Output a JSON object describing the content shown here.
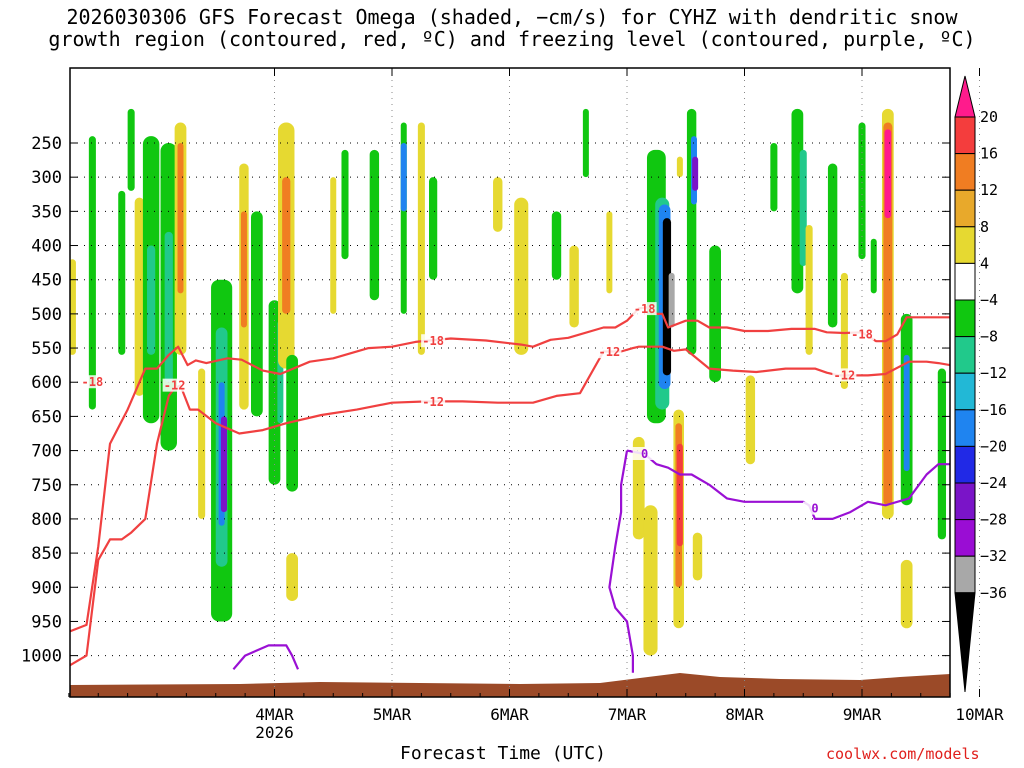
{
  "title_line1": "2026030306 GFS Forecast Omega (shaded, −cm/s) for CYHZ with dendritic snow",
  "title_line2": "growth region (contoured, red, ºC) and freezing level (contoured, purple, ºC)",
  "credit": "coolwx.com/models",
  "chart_data": {
    "type": "heatmap",
    "title": "2026030306 GFS Forecast Omega (shaded, −cm/s) for CYHZ with dendritic snow growth region (contoured, red, ºC) and freezing level (contoured, purple, ºC)",
    "xlabel": "Forecast Time (UTC)",
    "ylabel": "",
    "x_ticks": [
      {
        "label": "4MAR",
        "sub": "2026",
        "day": 1
      },
      {
        "label": "5MAR",
        "sub": "",
        "day": 2
      },
      {
        "label": "6MAR",
        "sub": "",
        "day": 3
      },
      {
        "label": "7MAR",
        "sub": "",
        "day": 4
      },
      {
        "label": "8MAR",
        "sub": "",
        "day": 5
      },
      {
        "label": "9MAR",
        "sub": "",
        "day": 6
      },
      {
        "label": "10MAR",
        "sub": "",
        "day": 7
      }
    ],
    "xlim_days": [
      -0.75,
      6.75
    ],
    "y_ticks": [
      250,
      300,
      350,
      400,
      450,
      500,
      550,
      600,
      650,
      700,
      750,
      800,
      850,
      900,
      950,
      1000
    ],
    "ylim_hpa": [
      200,
      1025
    ],
    "y_scale": "linear-pressure",
    "grid": "dotted",
    "colorbar": {
      "labels": [
        "20",
        "16",
        "12",
        "8",
        "4",
        "−4",
        "−8",
        "−12",
        "−16",
        "−20",
        "−24",
        "−28",
        "−32",
        "−36"
      ],
      "colors": [
        "#ff1b8c",
        "#f43d3d",
        "#f07d22",
        "#e8a92b",
        "#e6d931",
        "#ffffff",
        "#10c710",
        "#21c98b",
        "#22b8d6",
        "#1f84f0",
        "#2129e6",
        "#7a14c8",
        "#9a0dd4",
        "#a8a8a8",
        "#000000"
      ]
    },
    "omega_regions": [
      {
        "x": -0.72,
        "p1": 420,
        "p2": 560,
        "hw": 0.03,
        "c": "#e6d931"
      },
      {
        "x": -0.55,
        "p1": 240,
        "p2": 640,
        "hw": 0.03,
        "c": "#10c710"
      },
      {
        "x": -0.3,
        "p1": 320,
        "p2": 560,
        "hw": 0.03,
        "c": "#10c710"
      },
      {
        "x": -0.15,
        "p1": 330,
        "p2": 620,
        "hw": 0.04,
        "c": "#e6d931"
      },
      {
        "x": -0.22,
        "p1": 200,
        "p2": 320,
        "hw": 0.03,
        "c": "#10c710"
      },
      {
        "x": -0.05,
        "p1": 240,
        "p2": 660,
        "hw": 0.07,
        "c": "#10c710"
      },
      {
        "x": -0.05,
        "p1": 400,
        "p2": 560,
        "hw": 0.035,
        "c": "#21c98b"
      },
      {
        "x": 0.1,
        "p1": 250,
        "p2": 700,
        "hw": 0.07,
        "c": "#10c710"
      },
      {
        "x": 0.1,
        "p1": 380,
        "p2": 600,
        "hw": 0.035,
        "c": "#21c98b"
      },
      {
        "x": 0.2,
        "p1": 220,
        "p2": 560,
        "hw": 0.05,
        "c": "#e6d931"
      },
      {
        "x": 0.2,
        "p1": 250,
        "p2": 470,
        "hw": 0.025,
        "c": "#f07d22"
      },
      {
        "x": 0.55,
        "p1": 450,
        "p2": 950,
        "hw": 0.09,
        "c": "#10c710"
      },
      {
        "x": 0.55,
        "p1": 520,
        "p2": 870,
        "hw": 0.05,
        "c": "#21c98b"
      },
      {
        "x": 0.55,
        "p1": 600,
        "p2": 810,
        "hw": 0.025,
        "c": "#1f84f0"
      },
      {
        "x": 0.57,
        "p1": 650,
        "p2": 790,
        "hw": 0.015,
        "c": "#7a14c8"
      },
      {
        "x": 0.38,
        "p1": 580,
        "p2": 800,
        "hw": 0.03,
        "c": "#e6d931"
      },
      {
        "x": 0.74,
        "p1": 280,
        "p2": 640,
        "hw": 0.04,
        "c": "#e6d931"
      },
      {
        "x": 0.74,
        "p1": 350,
        "p2": 520,
        "hw": 0.02,
        "c": "#f07d22"
      },
      {
        "x": 0.85,
        "p1": 350,
        "p2": 650,
        "hw": 0.05,
        "c": "#10c710"
      },
      {
        "x": 1.0,
        "p1": 480,
        "p2": 750,
        "hw": 0.05,
        "c": "#10c710"
      },
      {
        "x": 1.05,
        "p1": 510,
        "p2": 660,
        "hw": 0.025,
        "c": "#21c98b"
      },
      {
        "x": 1.1,
        "p1": 220,
        "p2": 580,
        "hw": 0.07,
        "c": "#e6d931"
      },
      {
        "x": 1.1,
        "p1": 300,
        "p2": 500,
        "hw": 0.035,
        "c": "#f07d22"
      },
      {
        "x": 1.15,
        "p1": 560,
        "p2": 760,
        "hw": 0.05,
        "c": "#10c710"
      },
      {
        "x": 1.15,
        "p1": 850,
        "p2": 920,
        "hw": 0.05,
        "c": "#e6d931"
      },
      {
        "x": 1.5,
        "p1": 300,
        "p2": 500,
        "hw": 0.02,
        "c": "#e6d931"
      },
      {
        "x": 1.6,
        "p1": 260,
        "p2": 420,
        "hw": 0.03,
        "c": "#10c710"
      },
      {
        "x": 1.85,
        "p1": 260,
        "p2": 480,
        "hw": 0.04,
        "c": "#10c710"
      },
      {
        "x": 2.1,
        "p1": 220,
        "p2": 500,
        "hw": 0.025,
        "c": "#10c710"
      },
      {
        "x": 2.1,
        "p1": 250,
        "p2": 350,
        "hw": 0.012,
        "c": "#1f84f0"
      },
      {
        "x": 2.25,
        "p1": 220,
        "p2": 560,
        "hw": 0.03,
        "c": "#e6d931"
      },
      {
        "x": 2.35,
        "p1": 300,
        "p2": 450,
        "hw": 0.035,
        "c": "#10c710"
      },
      {
        "x": 2.9,
        "p1": 300,
        "p2": 380,
        "hw": 0.04,
        "c": "#e6d931"
      },
      {
        "x": 3.1,
        "p1": 330,
        "p2": 560,
        "hw": 0.06,
        "c": "#e6d931"
      },
      {
        "x": 3.4,
        "p1": 350,
        "p2": 450,
        "hw": 0.04,
        "c": "#10c710"
      },
      {
        "x": 3.55,
        "p1": 400,
        "p2": 520,
        "hw": 0.04,
        "c": "#e6d931"
      },
      {
        "x": 3.65,
        "p1": 200,
        "p2": 300,
        "hw": 0.015,
        "c": "#10c710"
      },
      {
        "x": 3.85,
        "p1": 350,
        "p2": 470,
        "hw": 0.02,
        "c": "#e6d931"
      },
      {
        "x": 4.1,
        "p1": 680,
        "p2": 830,
        "hw": 0.05,
        "c": "#e6d931"
      },
      {
        "x": 4.2,
        "p1": 780,
        "p2": 1000,
        "hw": 0.06,
        "c": "#e6d931"
      },
      {
        "x": 4.25,
        "p1": 260,
        "p2": 660,
        "hw": 0.08,
        "c": "#10c710"
      },
      {
        "x": 4.3,
        "p1": 330,
        "p2": 640,
        "hw": 0.06,
        "c": "#21c98b"
      },
      {
        "x": 4.32,
        "p1": 340,
        "p2": 610,
        "hw": 0.05,
        "c": "#1f84f0"
      },
      {
        "x": 4.34,
        "p1": 360,
        "p2": 590,
        "hw": 0.035,
        "c": "#000000"
      },
      {
        "x": 4.38,
        "p1": 440,
        "p2": 520,
        "hw": 0.025,
        "c": "#a8a8a8"
      },
      {
        "x": 4.44,
        "p1": 640,
        "p2": 960,
        "hw": 0.045,
        "c": "#e6d931"
      },
      {
        "x": 4.44,
        "p1": 660,
        "p2": 900,
        "hw": 0.028,
        "c": "#f07d22"
      },
      {
        "x": 4.45,
        "p1": 690,
        "p2": 840,
        "hw": 0.018,
        "c": "#f43d3d"
      },
      {
        "x": 4.55,
        "p1": 200,
        "p2": 560,
        "hw": 0.04,
        "c": "#10c710"
      },
      {
        "x": 4.57,
        "p1": 240,
        "p2": 340,
        "hw": 0.02,
        "c": "#1f84f0"
      },
      {
        "x": 4.58,
        "p1": 270,
        "p2": 320,
        "hw": 0.012,
        "c": "#7a14c8"
      },
      {
        "x": 4.45,
        "p1": 270,
        "p2": 300,
        "hw": 0.02,
        "c": "#e6d931"
      },
      {
        "x": 4.6,
        "p1": 820,
        "p2": 890,
        "hw": 0.04,
        "c": "#e6d931"
      },
      {
        "x": 4.75,
        "p1": 400,
        "p2": 600,
        "hw": 0.05,
        "c": "#10c710"
      },
      {
        "x": 5.05,
        "p1": 590,
        "p2": 720,
        "hw": 0.04,
        "c": "#e6d931"
      },
      {
        "x": 5.25,
        "p1": 250,
        "p2": 350,
        "hw": 0.03,
        "c": "#10c710"
      },
      {
        "x": 5.45,
        "p1": 200,
        "p2": 470,
        "hw": 0.05,
        "c": "#10c710"
      },
      {
        "x": 5.5,
        "p1": 260,
        "p2": 430,
        "hw": 0.03,
        "c": "#21c98b"
      },
      {
        "x": 5.55,
        "p1": 370,
        "p2": 560,
        "hw": 0.03,
        "c": "#e6d931"
      },
      {
        "x": 5.75,
        "p1": 280,
        "p2": 520,
        "hw": 0.04,
        "c": "#10c710"
      },
      {
        "x": 5.85,
        "p1": 440,
        "p2": 610,
        "hw": 0.03,
        "c": "#e6d931"
      },
      {
        "x": 6.0,
        "p1": 220,
        "p2": 420,
        "hw": 0.03,
        "c": "#10c710"
      },
      {
        "x": 6.1,
        "p1": 390,
        "p2": 470,
        "hw": 0.02,
        "c": "#10c710"
      },
      {
        "x": 6.22,
        "p1": 200,
        "p2": 800,
        "hw": 0.05,
        "c": "#e6d931"
      },
      {
        "x": 6.22,
        "p1": 220,
        "p2": 780,
        "hw": 0.038,
        "c": "#f07d22"
      },
      {
        "x": 6.22,
        "p1": 230,
        "p2": 360,
        "hw": 0.028,
        "c": "#ff1b8c"
      },
      {
        "x": 6.38,
        "p1": 500,
        "p2": 780,
        "hw": 0.05,
        "c": "#10c710"
      },
      {
        "x": 6.38,
        "p1": 560,
        "p2": 730,
        "hw": 0.025,
        "c": "#1f84f0"
      },
      {
        "x": 6.38,
        "p1": 860,
        "p2": 960,
        "hw": 0.05,
        "c": "#e6d931"
      },
      {
        "x": 6.68,
        "p1": 580,
        "p2": 830,
        "hw": 0.035,
        "c": "#10c710"
      }
    ],
    "contours": [
      {
        "name": "-18",
        "color": "#f04040",
        "points": [
          [
            -0.75,
            965
          ],
          [
            -0.6,
            955
          ],
          [
            -0.5,
            840
          ],
          [
            -0.4,
            690
          ],
          [
            -0.25,
            640
          ],
          [
            -0.1,
            580
          ],
          [
            0.0,
            580
          ],
          [
            0.1,
            560
          ],
          [
            0.18,
            548
          ],
          [
            0.26,
            575
          ],
          [
            0.33,
            568
          ],
          [
            0.42,
            572
          ],
          [
            0.6,
            565
          ],
          [
            0.72,
            567
          ],
          [
            0.9,
            583
          ],
          [
            1.05,
            588
          ],
          [
            1.3,
            570
          ],
          [
            1.5,
            565
          ],
          [
            1.8,
            550
          ],
          [
            2.0,
            548
          ],
          [
            2.2,
            541
          ],
          [
            2.5,
            536
          ],
          [
            2.8,
            539
          ],
          [
            3.1,
            545
          ],
          [
            3.2,
            548
          ],
          [
            3.35,
            538
          ],
          [
            3.5,
            535
          ],
          [
            3.8,
            520
          ],
          [
            3.9,
            520
          ],
          [
            4.0,
            510
          ],
          [
            4.1,
            492
          ],
          [
            4.2,
            490
          ],
          [
            4.25,
            500
          ],
          [
            4.3,
            500
          ],
          [
            4.35,
            520
          ],
          [
            4.5,
            510
          ],
          [
            4.6,
            510
          ],
          [
            4.7,
            520
          ],
          [
            4.85,
            520
          ],
          [
            5.0,
            525
          ],
          [
            5.2,
            525
          ],
          [
            5.4,
            522
          ],
          [
            5.6,
            522
          ],
          [
            5.7,
            527
          ],
          [
            5.85,
            528
          ],
          [
            6.0,
            527
          ],
          [
            6.12,
            540
          ],
          [
            6.2,
            540
          ],
          [
            6.3,
            530
          ],
          [
            6.38,
            505
          ],
          [
            6.55,
            505
          ],
          [
            6.75,
            505
          ]
        ],
        "labels": [
          {
            "x": -0.55,
            "p": 600
          },
          {
            "x": 2.35,
            "p": 540
          },
          {
            "x": 4.15,
            "p": 493
          },
          {
            "x": 6.0,
            "p": 530
          }
        ]
      },
      {
        "name": "-12",
        "color": "#f04040",
        "points": [
          [
            -0.75,
            1015
          ],
          [
            -0.6,
            1000
          ],
          [
            -0.5,
            860
          ],
          [
            -0.4,
            830
          ],
          [
            -0.3,
            830
          ],
          [
            -0.22,
            820
          ],
          [
            -0.1,
            800
          ],
          [
            0.0,
            690
          ],
          [
            0.1,
            620
          ],
          [
            0.15,
            608
          ],
          [
            0.2,
            605
          ],
          [
            0.28,
            640
          ],
          [
            0.35,
            640
          ],
          [
            0.5,
            660
          ],
          [
            0.7,
            675
          ],
          [
            0.9,
            670
          ],
          [
            1.1,
            660
          ],
          [
            1.4,
            648
          ],
          [
            1.7,
            640
          ],
          [
            2.0,
            630
          ],
          [
            2.3,
            628
          ],
          [
            2.6,
            628
          ],
          [
            2.9,
            630
          ],
          [
            3.2,
            630
          ],
          [
            3.4,
            620
          ],
          [
            3.6,
            616
          ],
          [
            3.8,
            555
          ],
          [
            3.95,
            555
          ],
          [
            4.05,
            550
          ],
          [
            4.1,
            548
          ],
          [
            4.3,
            548
          ],
          [
            4.4,
            554
          ],
          [
            4.5,
            552
          ],
          [
            4.7,
            580
          ],
          [
            4.9,
            583
          ],
          [
            5.1,
            585
          ],
          [
            5.35,
            580
          ],
          [
            5.6,
            580
          ],
          [
            5.7,
            586
          ],
          [
            5.8,
            590
          ],
          [
            6.0,
            590
          ],
          [
            6.05,
            590
          ],
          [
            6.2,
            588
          ],
          [
            6.4,
            570
          ],
          [
            6.55,
            570
          ],
          [
            6.65,
            572
          ],
          [
            6.75,
            575
          ]
        ],
        "labels": [
          {
            "x": 0.15,
            "p": 605
          },
          {
            "x": 2.35,
            "p": 629
          },
          {
            "x": 3.85,
            "p": 556
          },
          {
            "x": 5.85,
            "p": 590
          }
        ]
      },
      {
        "name": "0",
        "color": "#9a10d4",
        "points": [
          [
            4.0,
            700
          ],
          [
            4.15,
            705
          ],
          [
            4.25,
            720
          ],
          [
            4.35,
            725
          ],
          [
            4.45,
            735
          ],
          [
            4.55,
            735
          ],
          [
            4.7,
            750
          ],
          [
            4.85,
            770
          ],
          [
            5.0,
            775
          ],
          [
            5.2,
            775
          ],
          [
            5.35,
            775
          ],
          [
            5.5,
            775
          ],
          [
            5.55,
            780
          ],
          [
            5.6,
            800
          ],
          [
            5.75,
            800
          ],
          [
            5.9,
            790
          ],
          [
            6.05,
            775
          ],
          [
            6.2,
            780
          ],
          [
            6.4,
            770
          ],
          [
            6.55,
            735
          ],
          [
            6.65,
            720
          ],
          [
            6.75,
            720
          ]
        ],
        "labels": [
          {
            "x": 4.15,
            "p": 705
          },
          {
            "x": 5.6,
            "p": 785
          }
        ]
      },
      {
        "name": "0-low",
        "color": "#9a10d4",
        "points": [
          [
            4.0,
            700
          ],
          [
            3.95,
            750
          ],
          [
            3.95,
            790
          ],
          [
            3.9,
            840
          ],
          [
            3.85,
            900
          ],
          [
            3.9,
            930
          ],
          [
            4.0,
            950
          ],
          [
            4.05,
            1000
          ],
          [
            4.05,
            1025
          ]
        ],
        "labels": []
      },
      {
        "name": "0-surface",
        "color": "#9a10d4",
        "points": [
          [
            0.65,
            1020
          ],
          [
            0.75,
            1000
          ],
          [
            0.95,
            985
          ],
          [
            1.1,
            985
          ],
          [
            1.15,
            1000
          ],
          [
            1.2,
            1020
          ]
        ],
        "labels": []
      }
    ]
  }
}
